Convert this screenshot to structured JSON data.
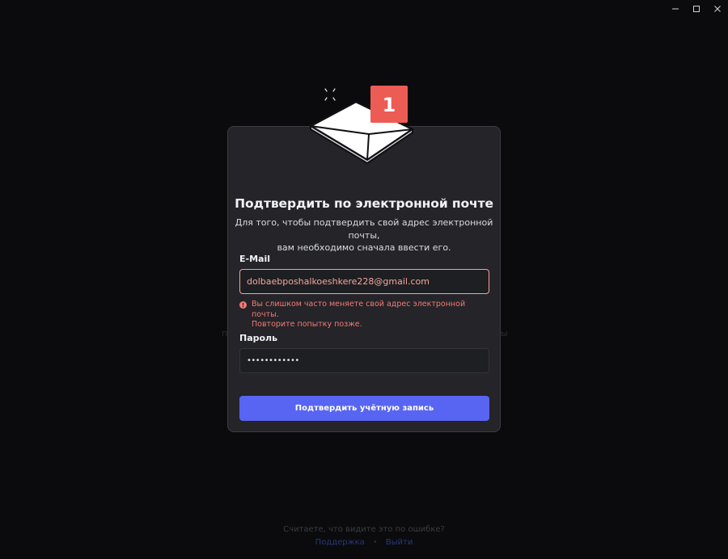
{
  "window": {
    "controls": [
      "minimize-icon",
      "maximize-icon",
      "close-icon"
    ]
  },
  "background": {
    "left_fragment": "п",
    "right_fragment": "ы"
  },
  "modal": {
    "badge_count": "1",
    "title": "Подтвердить по электронной почте",
    "subtitle_line1": "Для того, чтобы подтвердить свой адрес электронной почты,",
    "subtitle_line2": "вам необходимо сначала ввести его.",
    "email_label": "E-Mail",
    "email_value": "dolbaebposhalkoeshkere228@gmail.com",
    "error_line1": "Вы слишком часто меняете свой адрес электронной почты.",
    "error_line2": "Повторите попытку позже.",
    "password_label": "Пароль",
    "password_value": "••••••••••••",
    "submit_label": "Подтвердить учётную запись"
  },
  "footer": {
    "question": "Считаете, что видите это по ошибке?",
    "support_link": "Поддержка",
    "separator": "•",
    "logout_link": "Выйти"
  },
  "colors": {
    "background": "#0b0b0d",
    "modal": "#242429",
    "accent": "#5865f2",
    "error": "#f47a72",
    "badge": "#ed5b55"
  }
}
